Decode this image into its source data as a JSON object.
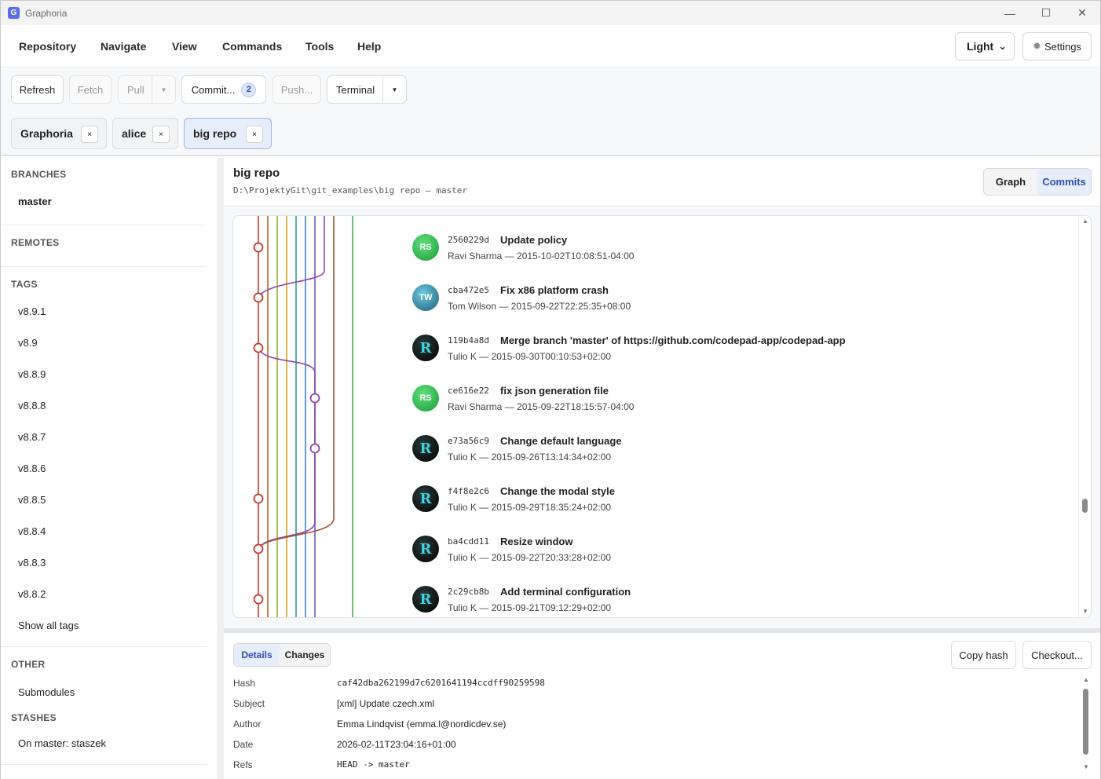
{
  "window": {
    "title": "Graphoria",
    "app_icon_letter": "G",
    "controls": [
      "—",
      "☐",
      "✕"
    ]
  },
  "menu": {
    "items": [
      "Repository",
      "Navigate",
      "View",
      "Commands",
      "Tools",
      "Help"
    ],
    "theme": "Light",
    "settings": "Settings"
  },
  "toolbar": {
    "refresh": "Refresh",
    "fetch": "Fetch",
    "pull": "Pull",
    "commit": "Commit...",
    "commit_count": "2",
    "push": "Push...",
    "terminal": "Terminal"
  },
  "repo_tabs": [
    {
      "label": "Graphoria"
    },
    {
      "label": "alice"
    },
    {
      "label": "big repo"
    }
  ],
  "sidebar": {
    "branches_title": "BRANCHES",
    "branches": [
      "master"
    ],
    "remotes_title": "REMOTES",
    "tags_title": "TAGS",
    "tags": [
      "v8.9.1",
      "v8.9",
      "v8.8.9",
      "v8.8.8",
      "v8.8.7",
      "v8.8.6",
      "v8.8.5",
      "v8.8.4",
      "v8.8.3",
      "v8.8.2"
    ],
    "show_all_tags": "Show all tags",
    "other_title": "OTHER",
    "submodules": "Submodules",
    "stashes_title": "STASHES",
    "stashes": [
      "On master: staszek"
    ]
  },
  "main": {
    "repo_name": "big repo",
    "repo_path": "D:\\ProjektyGit\\git_examples\\big repo — master",
    "view_graph": "Graph",
    "view_commits": "Commits"
  },
  "commits": [
    {
      "hash": "2560229d",
      "subject": "Update policy",
      "meta": "Ravi Sharma — 2015-10-02T10:08:51-04:00",
      "avatar": "RS",
      "avatar_kind": "rs"
    },
    {
      "hash": "cba472e5",
      "subject": "Fix x86 platform crash",
      "meta": "Tom Wilson — 2015-09-22T22:25:35+08:00",
      "avatar": "TW",
      "avatar_kind": "tw"
    },
    {
      "hash": "119b4a8d",
      "subject": "Merge branch 'master' of https://github.com/codepad-app/codepad-app",
      "meta": "Tulio K — 2015-09-30T00:10:53+02:00",
      "avatar": "R",
      "avatar_kind": "r"
    },
    {
      "hash": "ce616e22",
      "subject": "fix json generation file",
      "meta": "Ravi Sharma — 2015-09-22T18:15:57-04:00",
      "avatar": "RS",
      "avatar_kind": "rs"
    },
    {
      "hash": "e73a56c9",
      "subject": "Change default language",
      "meta": "Tulio K — 2015-09-26T13:14:34+02:00",
      "avatar": "R",
      "avatar_kind": "r"
    },
    {
      "hash": "f4f8e2c6",
      "subject": "Change the modal style",
      "meta": "Tulio K — 2015-09-29T18:35:24+02:00",
      "avatar": "R",
      "avatar_kind": "r"
    },
    {
      "hash": "ba4cdd11",
      "subject": "Resize window",
      "meta": "Tulio K — 2015-09-22T20:33:28+02:00",
      "avatar": "R",
      "avatar_kind": "r"
    },
    {
      "hash": "2c29cb8b",
      "subject": "Add terminal configuration",
      "meta": "Tulio K — 2015-09-21T09:12:29+02:00",
      "avatar": "R",
      "avatar_kind": "r"
    }
  ],
  "graph_lanes": {
    "colors": [
      "#c0392b",
      "#b5651d",
      "#8fb339",
      "#2a9d8f",
      "#3b82c4",
      "#4b3bb0",
      "#8e44ad",
      "#a0522d",
      "#4caf50"
    ]
  },
  "details": {
    "tab_details": "Details",
    "tab_changes": "Changes",
    "copy_hash": "Copy hash",
    "checkout": "Checkout...",
    "fields": [
      {
        "label": "Hash",
        "value": "caf42dba262199d7c6201641194ccdff90259598"
      },
      {
        "label": "Subject",
        "value": "[xml] Update czech.xml"
      },
      {
        "label": "Author",
        "value": "Emma Lindqvist (emma.l@nordicdev.se)"
      },
      {
        "label": "Date",
        "value": "2026-02-11T23:04:16+01:00"
      },
      {
        "label": "Refs",
        "value": "HEAD -> master"
      }
    ]
  }
}
